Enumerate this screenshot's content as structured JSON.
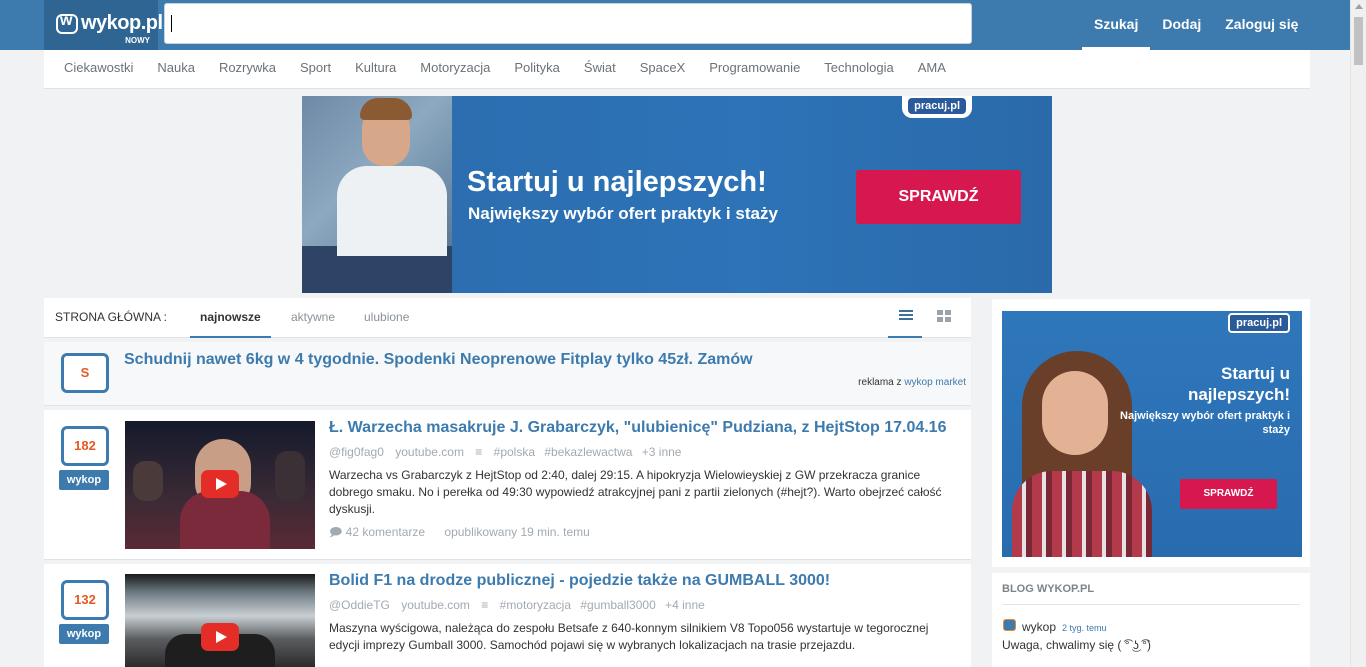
{
  "header": {
    "logo_text": "wykop.pl",
    "logo_sub": "NOWY",
    "search_value": "",
    "links": [
      "Szukaj",
      "Dodaj",
      "Zaloguj się"
    ]
  },
  "categories": [
    "Ciekawostki",
    "Nauka",
    "Rozrywka",
    "Sport",
    "Kultura",
    "Motoryzacja",
    "Polityka",
    "Świat",
    "SpaceX",
    "Programowanie",
    "Technologia",
    "AMA"
  ],
  "banner": {
    "badge": "pracuj.pl",
    "headline": "Startuj u najlepszych!",
    "subline": "Największy wybór ofert praktyk i staży",
    "button": "SPRAWDŹ"
  },
  "tabs": {
    "label": "STRONA GŁÓWNA :",
    "items": [
      "najnowsze",
      "aktywne",
      "ulubione"
    ],
    "active": "najnowsze"
  },
  "promo": {
    "score": "S",
    "title": "Schudnij nawet 6kg w 4 tygodnie. Spodenki Neoprenowe Fitplay tylko 45zł. Zamów",
    "foot_prefix": "reklama z",
    "foot_link": "wykop market"
  },
  "links": [
    {
      "votes": "182",
      "vote_button": "wykop",
      "title": "Ł. Warzecha masakruje J. Grabarczyk, \"ulubienicę\" Pudziana, z HejtStop 17.04.16",
      "author": "@fig0fag0",
      "domain": "youtube.com",
      "tags": [
        "#polska",
        "#bekazlewactwa"
      ],
      "more": "+3 inne",
      "description": "Warzecha vs Grabarczyk z HejtStop od 2:40, dalej 29:15. A hipokryzja Wielowieyskiej z GW przekracza granice dobrego smaku. No i perełka od 49:30 wypowiedź atrakcyjnej pani z partii zielonych (#hejt?). Warto obejrzeć całość dyskusji.",
      "comments": "42 komentarze",
      "published": "opublikowany 19 min. temu"
    },
    {
      "votes": "132",
      "vote_button": "wykop",
      "title": "Bolid F1 na drodze publicznej - pojedzie także na GUMBALL 3000!",
      "author": "@OddieTG",
      "domain": "youtube.com",
      "tags": [
        "#motoryzacja",
        "#gumball3000"
      ],
      "more": "+4 inne",
      "description": "Maszyna wyścigowa, należąca do zespołu Betsafe z 640-konnym silnikiem V8 Topo056 wystartuje w tegorocznej edycji imprezy Gumball 3000. Samochód pojawi się w wybranych lokalizacjach na trasie przejazdu."
    }
  ],
  "sidebar_ad": {
    "badge": "pracuj.pl",
    "headline": "Startuj u najlepszych!",
    "subline": "Największy wybór ofert praktyk i staży",
    "button": "SPRAWDŹ"
  },
  "blog": {
    "title": "BLOG WYKOP.PL",
    "author": "wykop",
    "time": "2 tyg. temu",
    "text": "Uwaga, chwalimy się ( ͡° ͜ʖ ͡°)"
  },
  "colors": {
    "brand_blue": "#3d7aad",
    "vote_orange": "#e35a24",
    "cta_red": "#d6184f"
  }
}
